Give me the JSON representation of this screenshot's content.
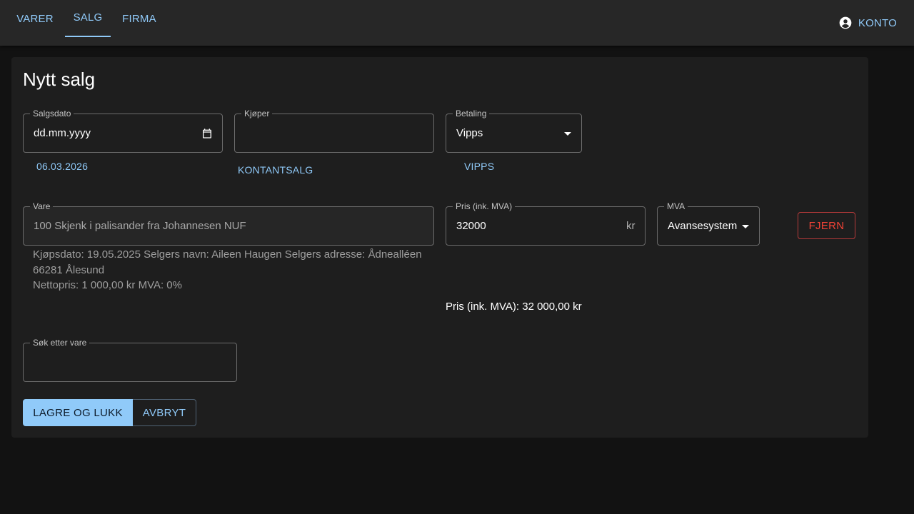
{
  "nav": {
    "tabs": [
      {
        "label": "VARER"
      },
      {
        "label": "SALG"
      },
      {
        "label": "FIRMA"
      }
    ],
    "account_label": "KONTO",
    "accent_color": "#90caf9"
  },
  "form": {
    "title": "Nytt salg",
    "sale_date": {
      "label": "Salgsdato",
      "placeholder": "dd.mm.yyyy",
      "quick_date": "06.03.2026"
    },
    "buyer": {
      "label": "Kjøper",
      "value": "",
      "quick_option": "KONTANTSALG"
    },
    "payment": {
      "label": "Betaling",
      "value": "Vipps",
      "quick_option": "VIPPS"
    },
    "item": {
      "label": "Vare",
      "value": "100 Skjenk i palisander fra Johannesen NUF",
      "details_line1": "Kjøpsdato: 19.05.2025 Selgers navn: Aileen Haugen Selgers adresse: Ådnealléen 66281 Ålesund",
      "details_line2": "Nettopris: 1 000,00 kr MVA: 0%"
    },
    "price": {
      "label": "Pris (ink. MVA)",
      "value": "32000",
      "unit": "kr",
      "summary": "Pris (ink. MVA): 32 000,00 kr"
    },
    "vat": {
      "label": "MVA",
      "value": "Avansesystem"
    },
    "remove_label": "FJERN",
    "search": {
      "label": "Søk etter vare",
      "value": ""
    },
    "save_label": "LAGRE OG LUKK",
    "cancel_label": "AVBRYT"
  }
}
